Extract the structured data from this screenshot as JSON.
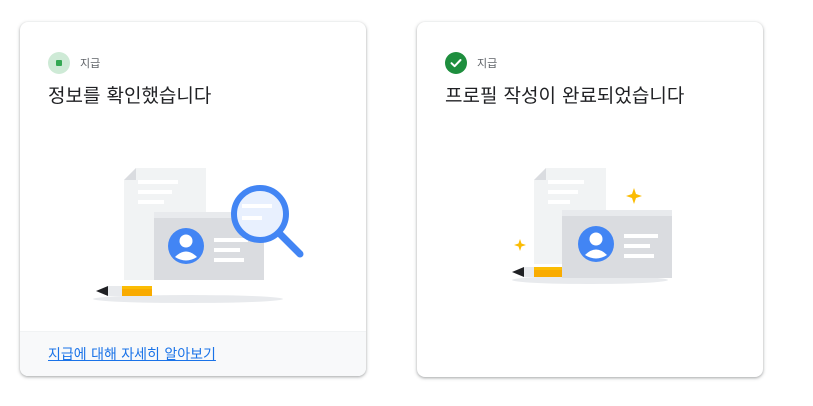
{
  "cards": [
    {
      "status_label": "지급",
      "status_icon": "pending-status-icon",
      "title": "정보를 확인했습니다",
      "illustration": "document-id-card-magnifier-illustration",
      "footer_link": "지급에 대해 자세히 알아보기"
    },
    {
      "status_label": "지급",
      "status_icon": "check-circle-icon",
      "title": "프로필 작성이 완료되었습니다",
      "illustration": "document-id-card-sparkles-illustration"
    }
  ],
  "colors": {
    "accent_blue": "#1a73e8",
    "success_green": "#1e8e3e",
    "pending_green_bg": "#ceead6",
    "pencil_yellow": "#f9ab00",
    "avatar_blue": "#4285f4"
  }
}
